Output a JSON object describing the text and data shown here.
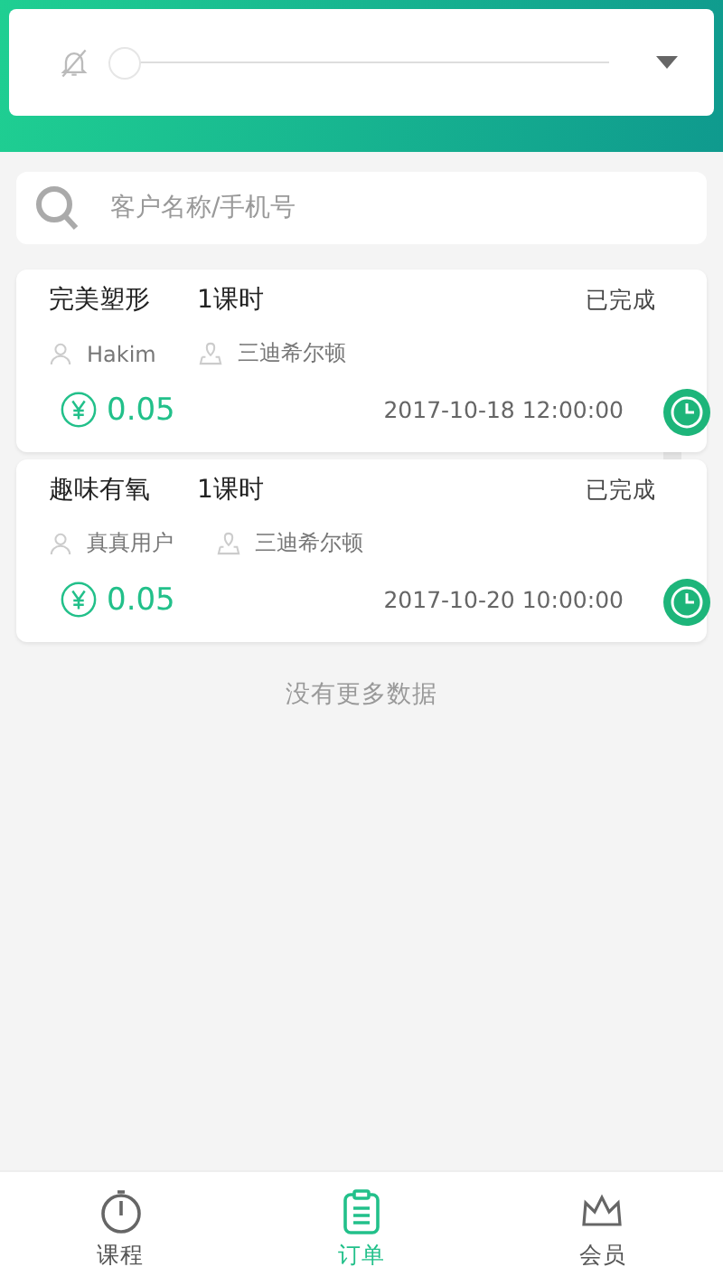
{
  "header": {
    "muted": true,
    "slider": {
      "level": 0
    }
  },
  "search": {
    "placeholder": "客户名称/手机号"
  },
  "orders": [
    {
      "course": "完美塑形",
      "hours": "1课时",
      "status": "已完成",
      "customer": "Hakim",
      "location": "三迪希尔顿",
      "price": "0.05",
      "time": "2017-10-18 12:00:00"
    },
    {
      "course": "趣味有氧",
      "hours": "1课时",
      "status": "已完成",
      "customer": "真真用户",
      "location": "三迪希尔顿",
      "price": "0.05",
      "time": "2017-10-20 10:00:00"
    }
  ],
  "end_note": "没有更多数据",
  "tabs": [
    {
      "kind": "timer",
      "label": "课程",
      "selected": false
    },
    {
      "kind": "clipboard",
      "label": "订单",
      "selected": true
    },
    {
      "kind": "crown",
      "label": "会员",
      "selected": false
    }
  ]
}
